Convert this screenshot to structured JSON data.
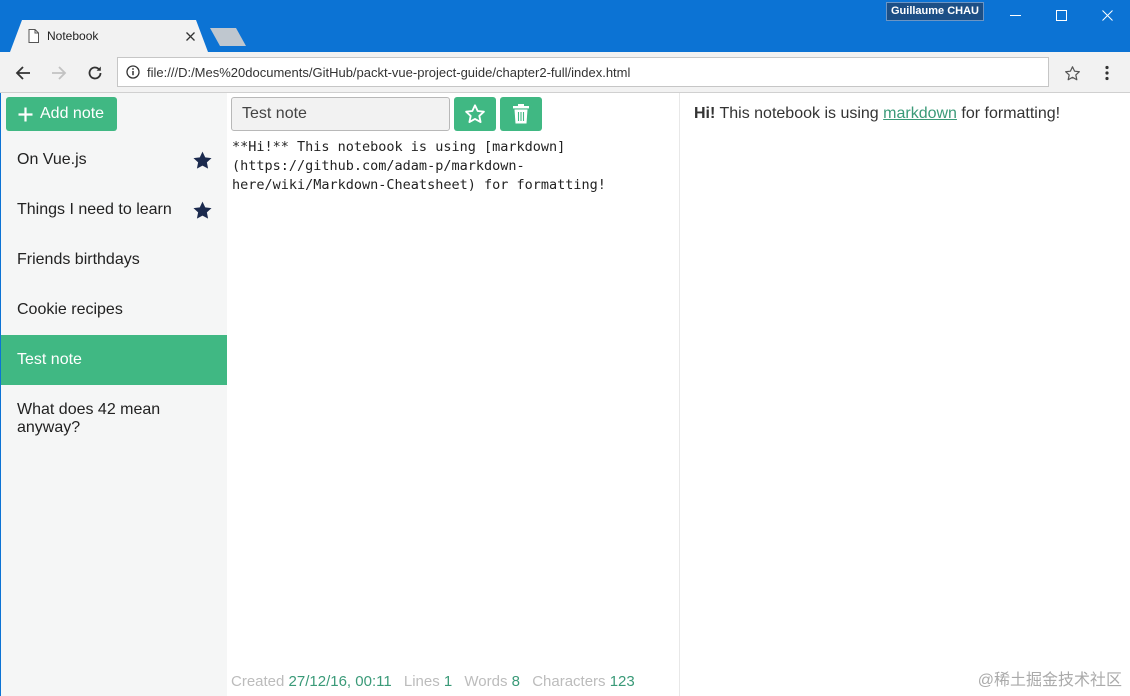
{
  "window": {
    "user_name": "Guillaume CHAU",
    "tab_title": "Notebook",
    "url": "file:///D:/Mes%20documents/GitHub/packt-vue-project-guide/chapter2-full/index.html"
  },
  "sidebar": {
    "add_button_label": "Add note",
    "notes": [
      {
        "title": "On Vue.js",
        "favorite": true,
        "selected": false
      },
      {
        "title": "Things I need to learn",
        "favorite": true,
        "selected": false
      },
      {
        "title": "Friends birthdays",
        "favorite": false,
        "selected": false
      },
      {
        "title": "Cookie recipes",
        "favorite": false,
        "selected": false
      },
      {
        "title": "Test note",
        "favorite": false,
        "selected": true
      },
      {
        "title": "What does 42 mean anyway?",
        "favorite": false,
        "selected": false
      }
    ]
  },
  "editor": {
    "title_value": "Test note",
    "content": "**Hi!** This notebook is using [markdown](https://github.com/adam-p/markdown-here/wiki/Markdown-Cheatsheet) for formatting!"
  },
  "status": {
    "created_label": "Created",
    "created_value": "27/12/16, 00:11",
    "lines_label": "Lines",
    "lines_value": "1",
    "words_label": "Words",
    "words_value": "8",
    "chars_label": "Characters",
    "chars_value": "123"
  },
  "preview": {
    "bold": "Hi!",
    "before_link": " This notebook is using ",
    "link": "markdown",
    "after_link": " for formatting!"
  },
  "watermark": "@稀土掘金技术社区",
  "colors": {
    "accent": "#40b883",
    "titlebar": "#0c73d4",
    "star": "#1b2a4e"
  },
  "icons": {
    "favorite": "star-filled-icon",
    "toggle_favorite": "star-outline-icon",
    "delete": "trash-icon",
    "add": "plus-icon"
  }
}
